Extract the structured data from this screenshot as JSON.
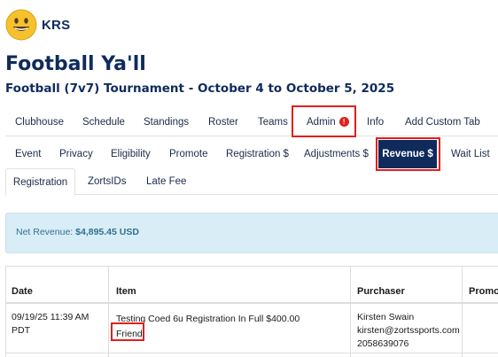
{
  "brand": {
    "name": "KRS",
    "logo_icon": "smiley-face-icon"
  },
  "event": {
    "title": "Football Ya'll",
    "subtitle": "Football (7v7) Tournament  -  October 4 to October 5, 2025"
  },
  "main_tabs": [
    {
      "label": "Clubhouse"
    },
    {
      "label": "Schedule"
    },
    {
      "label": "Standings"
    },
    {
      "label": "Roster"
    },
    {
      "label": "Teams"
    },
    {
      "label": "Admin",
      "alert": "!"
    },
    {
      "label": "Info"
    },
    {
      "label": "Add Custom Tab"
    }
  ],
  "admin_tabs": [
    {
      "label": "Event"
    },
    {
      "label": "Privacy"
    },
    {
      "label": "Eligibility"
    },
    {
      "label": "Promote"
    },
    {
      "label": "Registration $"
    },
    {
      "label": "Adjustments $"
    },
    {
      "label": "Revenue $",
      "active": true
    },
    {
      "label": "Wait List"
    }
  ],
  "revenue_tabs": [
    {
      "label": "Registration",
      "active": true
    },
    {
      "label": "ZortsIDs"
    },
    {
      "label": "Late Fee"
    }
  ],
  "net_revenue": {
    "label": "Net Revenue:",
    "value": "$4,895.45 USD"
  },
  "table": {
    "headers": {
      "date": "Date",
      "item": "Item",
      "purchaser": "Purchaser",
      "promo": "Promo"
    },
    "rows": [
      {
        "date_line1": "09/19/25 11:39 AM",
        "date_line2": "PDT",
        "item": "Testing Coed 6u Registration In Full $400.00",
        "item_tag": "Friend",
        "purchaser_name": "Kirsten Swain",
        "purchaser_email": "kirsten@zortssports.com",
        "purchaser_phone": "2058639076"
      }
    ]
  },
  "colors": {
    "navy": "#0f2b5c",
    "highlight_red": "#e0201c",
    "info_bg": "#d9edf7",
    "info_text": "#31708f"
  }
}
